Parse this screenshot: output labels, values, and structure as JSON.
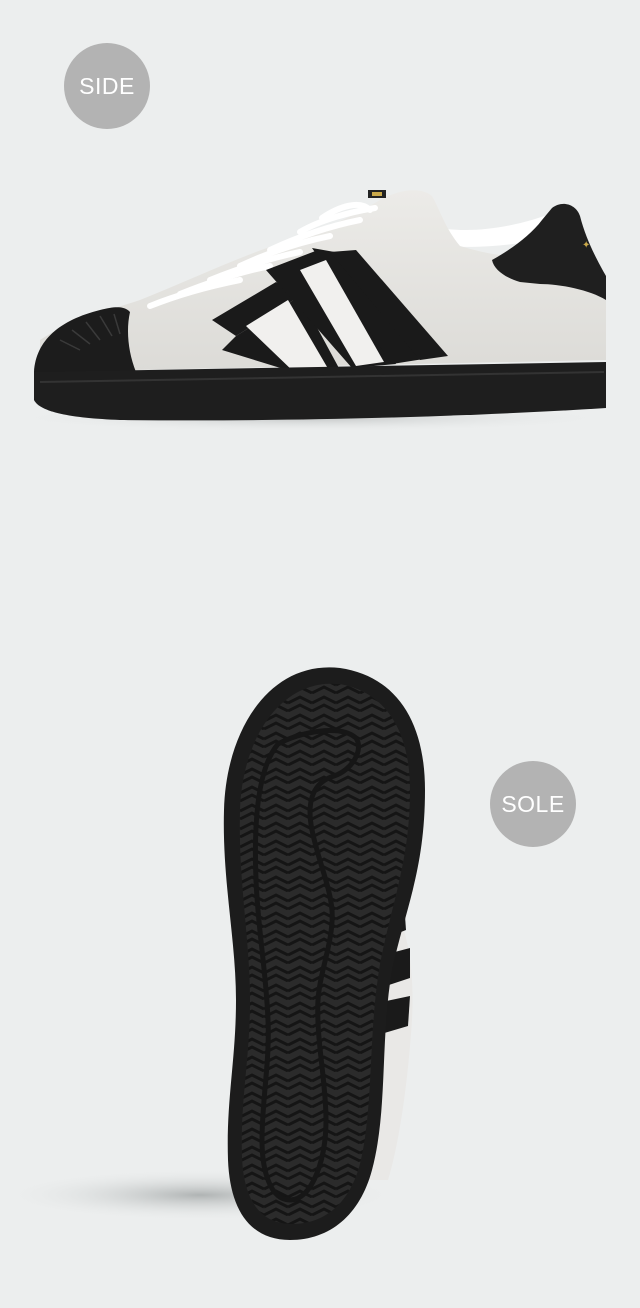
{
  "page": {
    "background_color": "#eceeee",
    "badge_color": "#b3b3b3"
  },
  "side_view": {
    "badge_label": "SIDE"
  },
  "sole_view": {
    "badge_label": "SOLE"
  }
}
